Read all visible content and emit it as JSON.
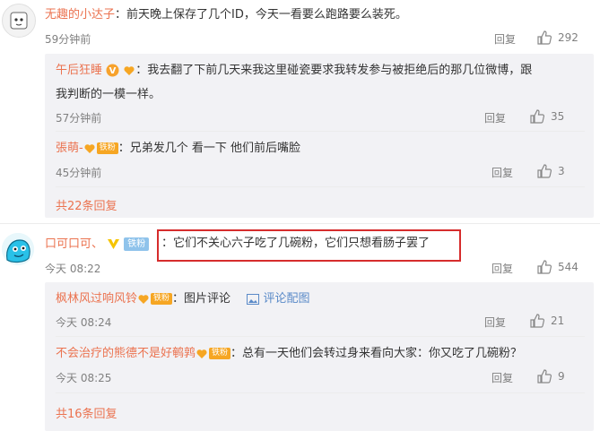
{
  "comments": [
    {
      "user": "无趣的小达子",
      "text": "：前天晚上保存了几个ID，今天一看要么跑路要么装死。",
      "time": "59分钟前",
      "reply_label": "回复",
      "likes": "292",
      "replies": [
        {
          "user": "午后狂睡",
          "badge": "V",
          "text": "：我去翻了下前几天来我这里碰瓷要求我转发参与被拒绝后的那几位微博，跟",
          "text2": "我判断的一模一样。",
          "time": "57分钟前",
          "likes": "35"
        },
        {
          "user": "張萌-",
          "fan_tag": "铁粉",
          "text": "：兄弟发几个  看一下 他们前后嘴脸",
          "time": "45分钟前",
          "likes": "3"
        }
      ],
      "more_replies": "共22条回复"
    },
    {
      "user": "口可口可、",
      "badge": "V",
      "fan_tag": "铁粉",
      "text": "：它们不关心六子吃了几碗粉，它们只想看肠子罢了",
      "time": "今天 08:22",
      "reply_label": "回复",
      "likes": "544",
      "replies": [
        {
          "user": "枫林风过响风铃",
          "fan_tag": "铁粉",
          "text": "：图片评论",
          "image_link": "评论配图",
          "time": "今天 08:24",
          "likes": "21"
        },
        {
          "user": "不会治疗的熊德不是好鹌鹑",
          "fan_tag": "铁粉",
          "text": "：总有一天他们会转过身来看向大家：你又吃了几碗粉？",
          "time": "今天 08:25",
          "likes": "9"
        }
      ],
      "more_replies": "共16条回复"
    }
  ],
  "colors": {
    "username": "#eb7350",
    "sub_bg": "#f2f2f5",
    "highlight_box": "#d62c2c",
    "fan_badge": "#f6a623"
  }
}
